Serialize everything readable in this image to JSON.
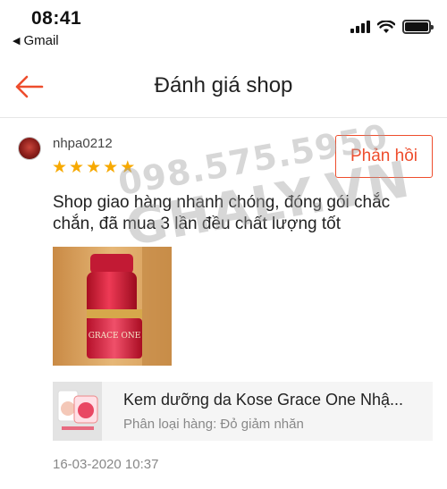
{
  "status_bar": {
    "time": "08:41",
    "back_app": "Gmail"
  },
  "header": {
    "title": "Đánh giá shop",
    "accent_color": "#ee4d2d"
  },
  "review": {
    "username": "nhpa0212",
    "rating": 5,
    "reply_label": "Phản hồi",
    "comment": "Shop giao hàng nhanh chóng, đóng gói chắc chắn, đã mua 3 lần đều chất lượng tốt",
    "photo_text": "GRACE ONE",
    "product": {
      "name": "Kem dưỡng da Kose Grace One Nhậ...",
      "variation": "Phân loại hàng: Đỏ giảm nhăn"
    },
    "date": "16-03-2020 10:37"
  },
  "watermark": {
    "phone": "098.575.5950",
    "site": "GHALY.VN"
  }
}
